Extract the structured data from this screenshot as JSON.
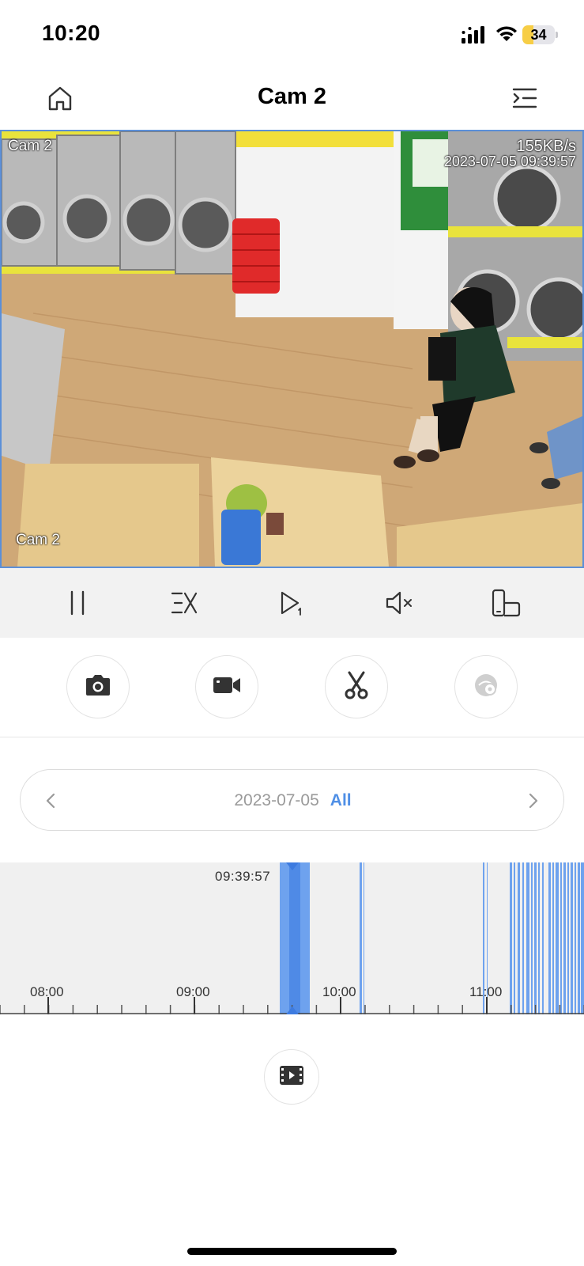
{
  "status_bar": {
    "time": "10:20",
    "battery_percent": 34,
    "battery_label": "34",
    "signal_icon": "cellular-signal-icon",
    "wifi_icon": "wifi-icon"
  },
  "header": {
    "title": "Cam 2",
    "left_icon": "home-icon",
    "right_icon": "menu-collapse-icon"
  },
  "video": {
    "osd_camera_name_top": "Cam 2",
    "osd_bitrate": "155KB/s",
    "osd_timestamp": "2023-07-05 09:39:57",
    "osd_camera_name_bottom": "Cam 2",
    "border_color": "#5b8fd8"
  },
  "playback_controls": [
    {
      "name": "pause",
      "icon": "pause-icon"
    },
    {
      "name": "speed",
      "icon": "playback-speed-icon"
    },
    {
      "name": "frame-step",
      "icon": "frame-step-icon"
    },
    {
      "name": "mute",
      "icon": "speaker-muted-icon"
    },
    {
      "name": "rotate",
      "icon": "rotate-screen-icon"
    }
  ],
  "action_buttons": [
    {
      "name": "snapshot",
      "icon": "camera-icon",
      "enabled": true
    },
    {
      "name": "record",
      "icon": "video-camera-icon",
      "enabled": true
    },
    {
      "name": "clip",
      "icon": "scissors-icon",
      "enabled": true
    },
    {
      "name": "privacy",
      "icon": "eye-scan-icon",
      "enabled": false
    }
  ],
  "date_selector": {
    "date": "2023-07-05",
    "filter": "All",
    "prev_icon": "chevron-left-icon",
    "next_icon": "chevron-right-icon",
    "accent_color": "#4f8fe6"
  },
  "timeline": {
    "current_time": "09:39:57",
    "hour_labels": [
      "08:00",
      "09:00",
      "10:00",
      "11:00"
    ],
    "recording_color": "#6ea2ee"
  },
  "record_list_button": {
    "icon": "film-strip-icon"
  }
}
